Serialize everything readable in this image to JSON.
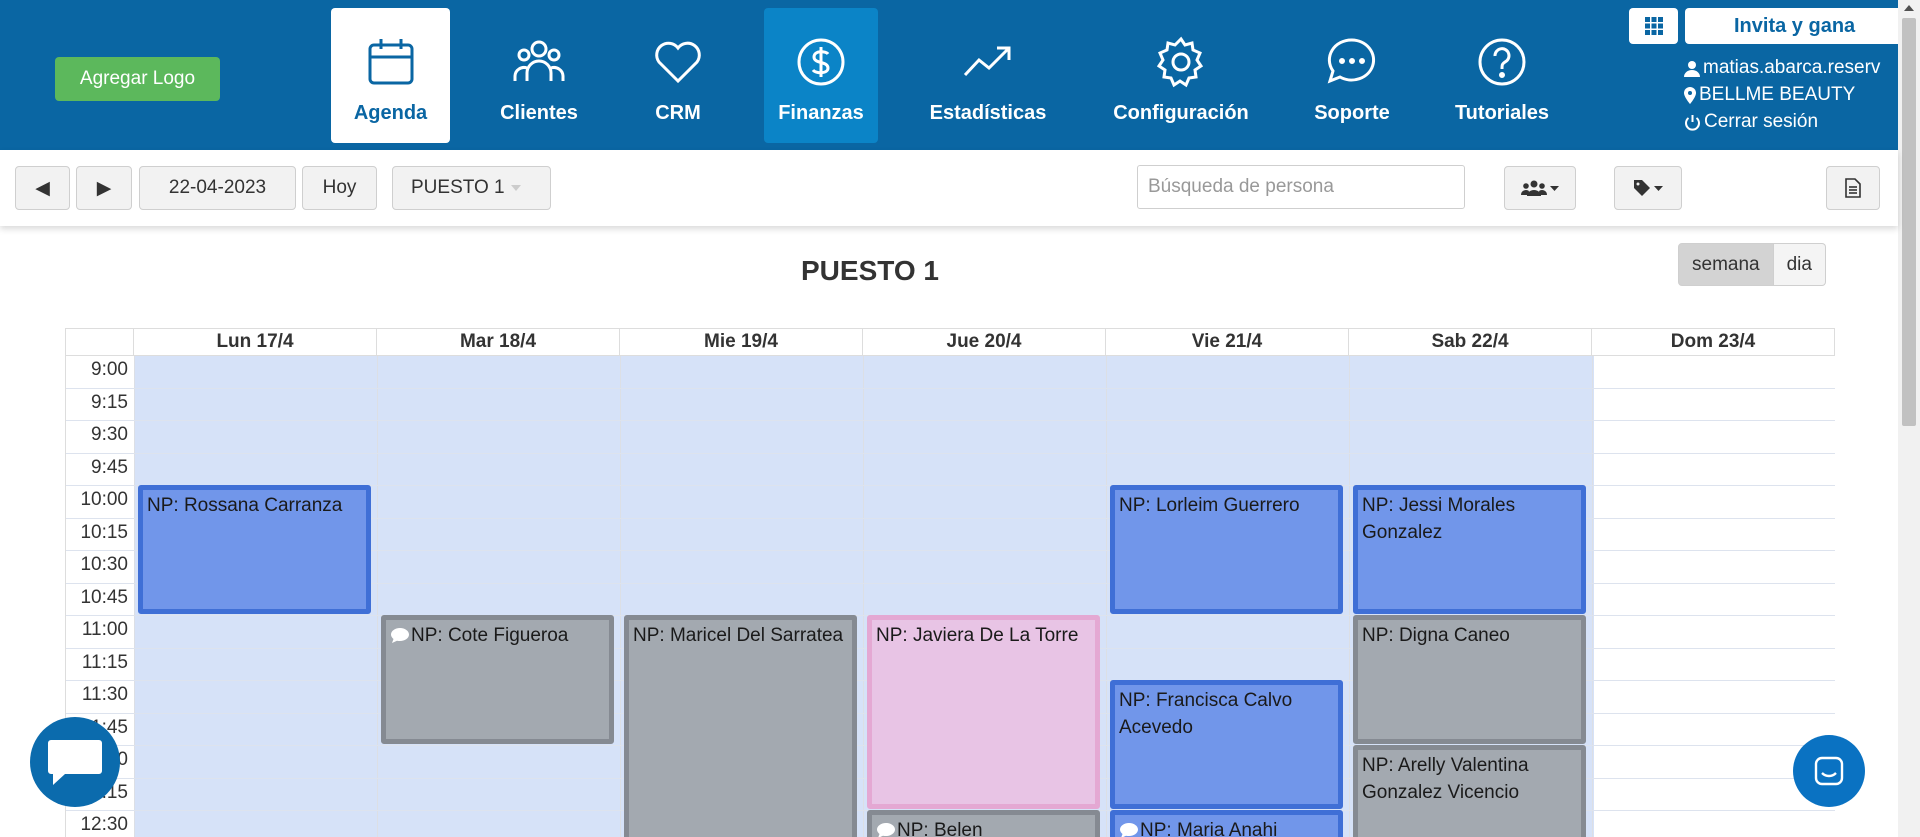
{
  "brand": {
    "logo_button": "Agregar Logo"
  },
  "nav": [
    {
      "label": "Agenda",
      "icon": "calendar-icon",
      "state": "active"
    },
    {
      "label": "Clientes",
      "icon": "users-icon",
      "state": "normal"
    },
    {
      "label": "CRM",
      "icon": "heart-icon",
      "state": "normal"
    },
    {
      "label": "Finanzas",
      "icon": "dollar-icon",
      "state": "highlight"
    },
    {
      "label": "Estadísticas",
      "icon": "trend-up-icon",
      "state": "normal"
    },
    {
      "label": "Configuración",
      "icon": "gear-icon",
      "state": "normal"
    },
    {
      "label": "Soporte",
      "icon": "chat-bubble-icon",
      "state": "normal"
    },
    {
      "label": "Tutoriales",
      "icon": "help-icon",
      "state": "normal"
    }
  ],
  "account": {
    "invite_label": "Invita y gana",
    "user": "matias.abarca.reserv",
    "business": "BELLME BEAUTY",
    "logout": "Cerrar sesión"
  },
  "toolbar": {
    "prev": "◀",
    "next": "▶",
    "date": "22-04-2023",
    "today": "Hoy",
    "resource": "PUESTO 1",
    "search_placeholder": "Búsqueda de persona"
  },
  "calendar": {
    "title": "PUESTO 1",
    "view_week": "semana",
    "view_day": "dia",
    "days": [
      "Lun 17/4",
      "Mar 18/4",
      "Mie 19/4",
      "Jue 20/4",
      "Vie 21/4",
      "Sab 22/4",
      "Dom 23/4"
    ],
    "times": [
      "9:00",
      "9:15",
      "9:30",
      "9:45",
      "10:00",
      "10:15",
      "10:30",
      "10:45",
      "11:00",
      "11:15",
      "11:30",
      "11:45",
      "12:00",
      "12:15",
      "12:30"
    ],
    "events": [
      {
        "day": 0,
        "start": "10:00",
        "end": "11:00",
        "title": "NP: Rossana Carranza",
        "style": "blue",
        "chat": false
      },
      {
        "day": 1,
        "start": "11:00",
        "end": "12:00",
        "title": "NP: Cote Figueroa",
        "style": "grey",
        "chat": true
      },
      {
        "day": 2,
        "start": "11:00",
        "end": "13:00",
        "title": "NP: Maricel Del Sarratea",
        "style": "grey",
        "chat": false
      },
      {
        "day": 3,
        "start": "11:00",
        "end": "12:30",
        "title": "NP: Javiera De La Torre",
        "style": "pink",
        "chat": false
      },
      {
        "day": 3,
        "start": "12:30",
        "end": "13:00",
        "title": "NP: Belen",
        "style": "grey",
        "chat": true
      },
      {
        "day": 4,
        "start": "10:00",
        "end": "11:00",
        "title": "NP: Lorleim Guerrero",
        "style": "blue",
        "chat": false
      },
      {
        "day": 4,
        "start": "11:30",
        "end": "12:30",
        "title": "NP: Francisca Calvo Acevedo",
        "style": "blue",
        "chat": false
      },
      {
        "day": 4,
        "start": "12:30",
        "end": "13:00",
        "title": "NP: Maria Anahi",
        "style": "blue",
        "chat": true
      },
      {
        "day": 5,
        "start": "10:00",
        "end": "11:00",
        "title": "NP: Jessi Morales Gonzalez",
        "style": "blue",
        "chat": false
      },
      {
        "day": 5,
        "start": "11:00",
        "end": "12:00",
        "title": "NP: Digna Caneo",
        "style": "grey",
        "chat": false
      },
      {
        "day": 5,
        "start": "12:00",
        "end": "13:00",
        "title": "NP: Arelly Valentina Gonzalez Vicencio",
        "style": "grey",
        "chat": false
      }
    ]
  },
  "colors": {
    "nav_bg": "#0a66a3",
    "nav_highlight": "#0b84c7",
    "logo_button": "#5cb85c",
    "available": "#d6e2f8",
    "event_blue": "#7196ea",
    "event_blue_border": "#3f6fd6",
    "event_grey": "#a3a9b0",
    "event_pink": "#e8c4e5"
  }
}
